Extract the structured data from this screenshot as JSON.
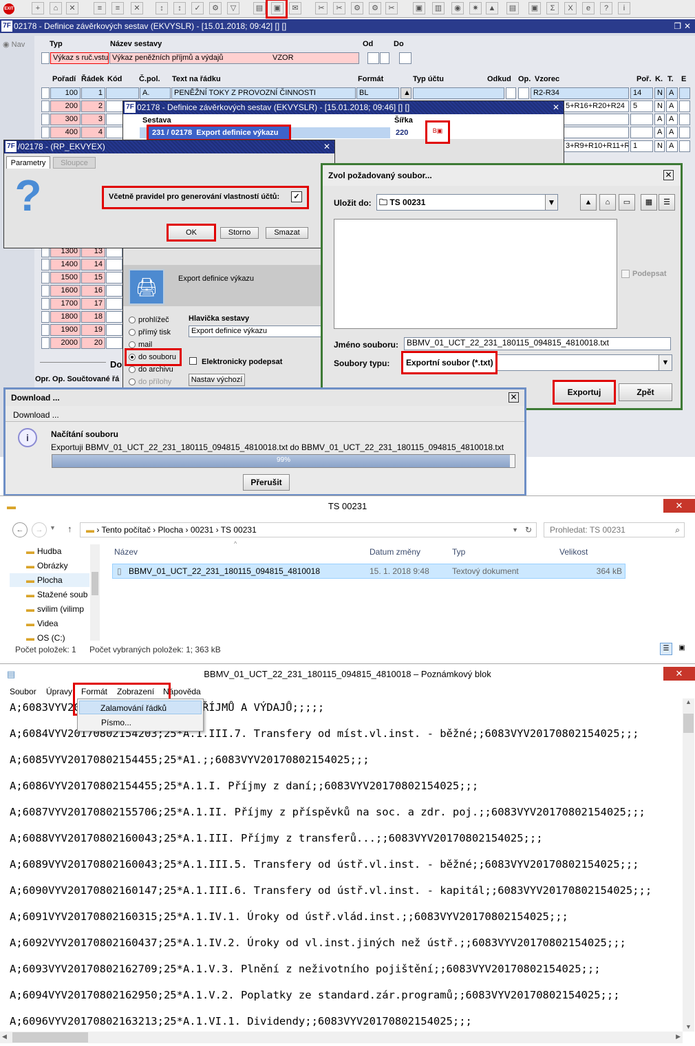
{
  "toolbar": {
    "exit": "EXIT",
    "tools": [
      "+",
      "⌂",
      "✕",
      "≡",
      "≡",
      "✕",
      "↕",
      "↕",
      "✓",
      "⚙",
      "▽",
      "▤",
      "▣",
      "✉",
      "✂",
      "✂",
      "⚙",
      "⚙",
      "✂",
      "▣",
      "▥",
      "◉",
      "✷",
      "▲",
      "▤",
      "▣",
      "Σ",
      "X",
      "e",
      "?",
      "i"
    ]
  },
  "main": {
    "title": "02178 - Definice závěrkových sestav (EKVYSLR) - [15.01.2018; 09:42] [] []",
    "nav": "Nav",
    "hdr": {
      "typ": "Typ",
      "nazev": "Název sestavy",
      "od": "Od",
      "do": "Do"
    },
    "typ": "Výkaz s ruč.vstu",
    "nazev": "Výkaz peněžních příjmů a výdajů",
    "vzor": "VZOR",
    "cols": {
      "poradi": "Pořadí",
      "radek": "Řádek",
      "kod": "Kód",
      "cpol": "Č.pol.",
      "text": "Text na řádku",
      "format": "Formát",
      "typuctu": "Typ účtu",
      "odkud": "Odkud",
      "op": "Op.",
      "vzorec": "Vzorec",
      "por": "Poř.",
      "k": "K.",
      "t": "T.",
      "e": "E"
    },
    "row1": {
      "poradi": "100",
      "radek": "1",
      "cpol": "A.",
      "text": "PENĚŽNÍ TOKY Z PROVOZNÍ ČINNOSTI",
      "format": "BL",
      "vzorec": "R2-R34",
      "por": "14",
      "k": "N",
      "t": "A"
    },
    "row2": {
      "poradi": "200",
      "radek": "2",
      "vzorec": "5+R16+R20+R24",
      "por": "5",
      "k": "N",
      "t": "A"
    },
    "row3": {
      "poradi": "300",
      "radek": "3",
      "k": "A",
      "t": "A"
    },
    "row4": {
      "poradi": "400",
      "radek": "4",
      "k": "A",
      "t": "A"
    },
    "row5": {
      "vzorec": "3+R9+R10+R11+R1",
      "por": "1",
      "k": "N",
      "t": "A"
    },
    "lower_rows": [
      {
        "poradi": "1300",
        "radek": "13"
      },
      {
        "poradi": "1400",
        "radek": "14"
      },
      {
        "poradi": "1500",
        "radek": "15"
      },
      {
        "poradi": "1600",
        "radek": "16"
      },
      {
        "poradi": "1700",
        "radek": "17"
      },
      {
        "poradi": "1800",
        "radek": "18"
      },
      {
        "poradi": "1900",
        "radek": "19"
      },
      {
        "poradi": "2000",
        "radek": "20"
      }
    ],
    "bottom_do": "Do",
    "bottom_opr": "Opr. Op. Součtované řá"
  },
  "dlg1": {
    "title": "02178 - Definice závěrkových sestav (EKVYSLR) - [15.01.2018; 09:46] [] []",
    "sestava": "Sestava",
    "sirka": "Šířka",
    "code": "231 / 02178",
    "name": "Export definice výkazu",
    "width": "220"
  },
  "print": {
    "title": "Export definice výkazu",
    "options": [
      "prohlížeč",
      "přímý tisk",
      "mail",
      "do souboru",
      "do archivu",
      "do přílohy"
    ],
    "hlavicka": "Hlavička sestavy",
    "hlavicka_val": "Export definice výkazu",
    "epodpis": "Elektronicky podepsat",
    "nastav": "Nastav výchozí"
  },
  "rp": {
    "title": "/02178 - (RP_EKVYEX)",
    "tab1": "Parametry",
    "tab2": "Sloupce",
    "label": "Včetně pravidel pro generování vlastností účtů:",
    "ok": "OK",
    "storno": "Storno",
    "smazat": "Smazat"
  },
  "save": {
    "title": "Zvol požadovaný soubor...",
    "ulozit": "Uložit do:",
    "folder": "TS 00231",
    "podepsat": "Podepsat",
    "jmeno": "Jméno souboru:",
    "filename": "BBMV_01_UCT_22_231_180115_094815_4810018.txt",
    "typ": "Soubory typu:",
    "typ_val": "Exportní soubor (*.txt)",
    "exportuj": "Exportuj",
    "zpet": "Zpět"
  },
  "dl": {
    "title": "Download ...",
    "sub": "Download ...",
    "heading": "Načítání souboru",
    "text": "Exportuji BBMV_01_UCT_22_231_180115_094815_4810018.txt do BBMV_01_UCT_22_231_180115_094815_4810018.txt",
    "progress_label": "99%",
    "progress": 0.99,
    "cancel": "Přerušit"
  },
  "explorer": {
    "title": "TS 00231",
    "path": [
      "Tento počítač",
      "Plocha",
      "00231",
      "TS 00231"
    ],
    "search": "Prohledat: TS 00231",
    "nav": [
      "Hudba",
      "Obrázky",
      "Plocha",
      "Stažené soub",
      "svilim (vilimp",
      "Videa",
      "OS (C:)"
    ],
    "cols": {
      "name": "Název",
      "date": "Datum změny",
      "type": "Typ",
      "size": "Velikost"
    },
    "file": {
      "name": "BBMV_01_UCT_22_231_180115_094815_4810018",
      "date": "15. 1. 2018 9:48",
      "type": "Textový dokument",
      "size": "364 kB"
    },
    "status1": "Počet položek: 1",
    "status2": "Počet vybraných položek: 1; 363 kB"
  },
  "notepad": {
    "title": "BBMV_01_UCT_22_231_180115_094815_4810018 – Poznámkový blok",
    "menu": [
      "Soubor",
      "Úpravy",
      "Formát",
      "Zobrazení",
      "Nápověda"
    ],
    "dropdown": [
      "Zalamování řádků",
      "Písmo..."
    ],
    "lines": [
      "A;6083VYV20  ... AZ PENĚŽNÍCH PŘÍJMŮ A VÝDAJŮ;;;;;",
      "A;6084VYV20170802154203;25*A.1.III.7. Transfery od míst.vl.inst. - běžné;;6083VYV20170802154025;;;",
      "A;6085VYV20170802154455;25*A1.;;6083VYV20170802154025;;;",
      "A;6086VYV20170802154455;25*A.1.I. Příjmy z daní;;6083VYV20170802154025;;;",
      "A;6087VYV20170802155706;25*A.1.II. Příjmy z příspěvků na soc. a zdr. poj.;;6083VYV20170802154025;;;",
      "A;6088VYV20170802160043;25*A.1.III. Příjmy z transferů...;;6083VYV20170802154025;;;",
      "A;6089VYV20170802160043;25*A.1.III.5. Transfery od ústř.vl.inst. - běžné;;6083VYV20170802154025;;;",
      "A;6090VYV20170802160147;25*A.1.III.6. Transfery od ústř.vl.inst. - kapitál;;6083VYV20170802154025;;;",
      "A;6091VYV20170802160315;25*A.1.IV.1. Úroky od ústř.vlád.inst.;;6083VYV20170802154025;;;",
      "A;6092VYV20170802160437;25*A.1.IV.2. Úroky od vl.inst.jiných než ústř.;;6083VYV20170802154025;;;",
      "A;6093VYV20170802162709;25*A.1.V.3. Plnění z neživotního pojištění;;6083VYV20170802154025;;;",
      "A;6094VYV20170802162950;25*A.1.V.2. Poplatky ze standard.zár.programů;;6083VYV20170802154025;;;",
      "A;6096VYV20170802163213;25*A.1.VI.1. Dividendy;;6083VYV20170802154025;;;"
    ]
  }
}
